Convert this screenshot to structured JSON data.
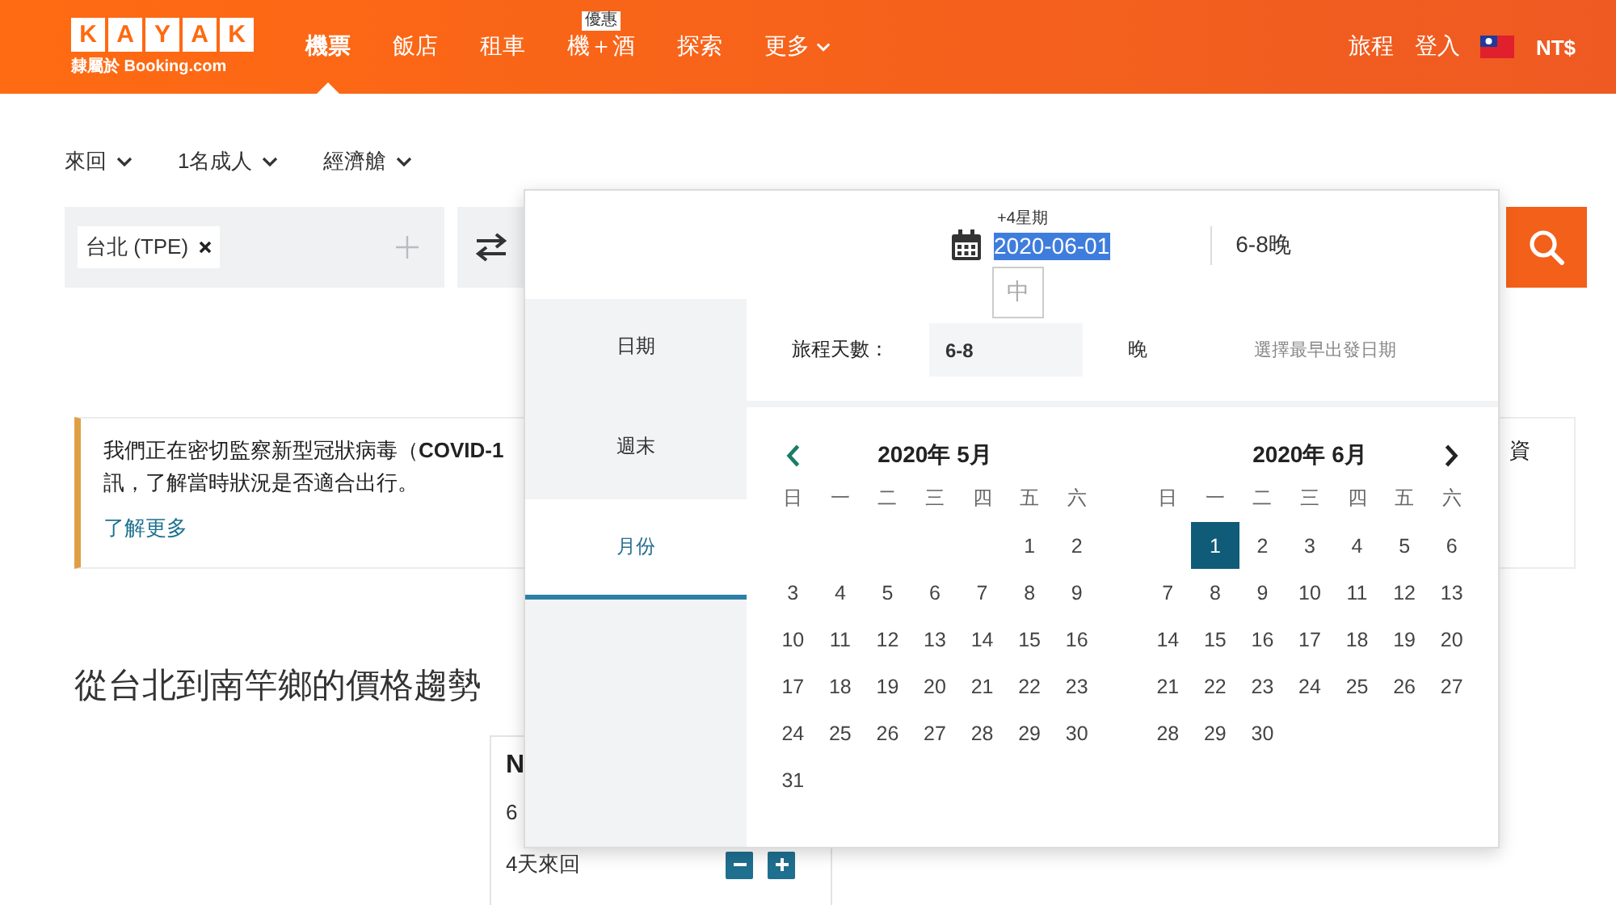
{
  "header": {
    "logo_letters": [
      "K",
      "A",
      "Y",
      "A",
      "K"
    ],
    "logo_tagline": "隸屬於 Booking.com",
    "nav": [
      {
        "label": "機票",
        "selected": true,
        "kind": "link"
      },
      {
        "label": "飯店",
        "selected": false,
        "kind": "link"
      },
      {
        "label": "租車",
        "selected": false,
        "kind": "link"
      },
      {
        "label": "機＋酒",
        "selected": false,
        "kind": "link",
        "badge": "優惠"
      },
      {
        "label": "探索",
        "selected": false,
        "kind": "link"
      },
      {
        "label": "更多",
        "selected": false,
        "kind": "dropdown"
      }
    ],
    "trips": "旅程",
    "sign_in": "登入",
    "currency": "NT$"
  },
  "trip_options": [
    "來回",
    "1名成人",
    "經濟艙"
  ],
  "search": {
    "origin_chip": "台北 (TPE)"
  },
  "notice": {
    "line1_start": "我們正在密切監察新型冠狀病毒（**COVID-1**",
    "line1_end": "資",
    "line2": "訊，了解當時狀況是否適合出行。",
    "link": "了解更多"
  },
  "section_title": "從台北到南竿鄉的價格趨勢",
  "price_card": {
    "title": "N",
    "subtitle": "6",
    "trip_length": "4天來回"
  },
  "date_picker": {
    "date_hint": "+4星期",
    "date_value": "2020-06-01",
    "ime_candidate": "中",
    "nights": "6-8晚",
    "tabs": [
      {
        "label": "日期",
        "selected": false
      },
      {
        "label": "週末",
        "selected": false
      },
      {
        "label": "月份",
        "selected": true
      }
    ],
    "trip_length": {
      "label": "旅程天數：",
      "value": "6-8",
      "unit": "晚",
      "hint": "選擇最早出發日期"
    },
    "months": [
      {
        "title": "2020年 5月",
        "weekdays": [
          "日",
          "一",
          "二",
          "三",
          "四",
          "五",
          "六"
        ],
        "weeks": [
          [
            {
              "day": "1",
              "selected": false
            },
            {
              "day": "2",
              "selected": false
            }
          ],
          [
            {
              "day": "3",
              "selected": false
            },
            {
              "day": "4",
              "selected": false
            },
            {
              "day": "5",
              "selected": false
            },
            {
              "day": "6",
              "selected": false
            },
            {
              "day": "7",
              "selected": false
            },
            {
              "day": "8",
              "selected": false
            },
            {
              "day": "9",
              "selected": false
            }
          ],
          [
            {
              "day": "10",
              "selected": false
            },
            {
              "day": "11",
              "selected": false
            },
            {
              "day": "12",
              "selected": false
            },
            {
              "day": "13",
              "selected": false
            },
            {
              "day": "14",
              "selected": false
            },
            {
              "day": "15",
              "selected": false
            },
            {
              "day": "16",
              "selected": false
            }
          ],
          [
            {
              "day": "17",
              "selected": false
            },
            {
              "day": "18",
              "selected": false
            },
            {
              "day": "19",
              "selected": false
            },
            {
              "day": "20",
              "selected": false
            },
            {
              "day": "21",
              "selected": false
            },
            {
              "day": "22",
              "selected": false
            },
            {
              "day": "23",
              "selected": false
            }
          ],
          [
            {
              "day": "24",
              "selected": false
            },
            {
              "day": "25",
              "selected": false
            },
            {
              "day": "26",
              "selected": false
            },
            {
              "day": "27",
              "selected": false
            },
            {
              "day": "28",
              "selected": false
            },
            {
              "day": "29",
              "selected": false
            },
            {
              "day": "30",
              "selected": false
            }
          ],
          [
            {
              "day": "31",
              "selected": false
            }
          ]
        ]
      },
      {
        "title": "2020年 6月",
        "weekdays": [
          "日",
          "一",
          "二",
          "三",
          "四",
          "五",
          "六"
        ],
        "weeks": [
          [
            {
              "day": "1",
              "selected": true
            },
            {
              "day": "2",
              "selected": false
            },
            {
              "day": "3",
              "selected": false
            },
            {
              "day": "4",
              "selected": false
            },
            {
              "day": "5",
              "selected": false
            },
            {
              "day": "6",
              "selected": false
            }
          ],
          [
            {
              "day": "7",
              "selected": false
            },
            {
              "day": "8",
              "selected": false
            },
            {
              "day": "9",
              "selected": false
            },
            {
              "day": "10",
              "selected": false
            },
            {
              "day": "11",
              "selected": false
            },
            {
              "day": "12",
              "selected": false
            },
            {
              "day": "13",
              "selected": false
            }
          ],
          [
            {
              "day": "14",
              "selected": false
            },
            {
              "day": "15",
              "selected": false
            },
            {
              "day": "16",
              "selected": false
            },
            {
              "day": "17",
              "selected": false
            },
            {
              "day": "18",
              "selected": false
            },
            {
              "day": "19",
              "selected": false
            },
            {
              "day": "20",
              "selected": false
            }
          ],
          [
            {
              "day": "21",
              "selected": false
            },
            {
              "day": "22",
              "selected": false
            },
            {
              "day": "23",
              "selected": false
            },
            {
              "day": "24",
              "selected": false
            },
            {
              "day": "25",
              "selected": false
            },
            {
              "day": "26",
              "selected": false
            },
            {
              "day": "27",
              "selected": false
            }
          ],
          [
            {
              "day": "28",
              "selected": false
            },
            {
              "day": "29",
              "selected": false
            },
            {
              "day": "30",
              "selected": false
            }
          ]
        ]
      }
    ]
  }
}
